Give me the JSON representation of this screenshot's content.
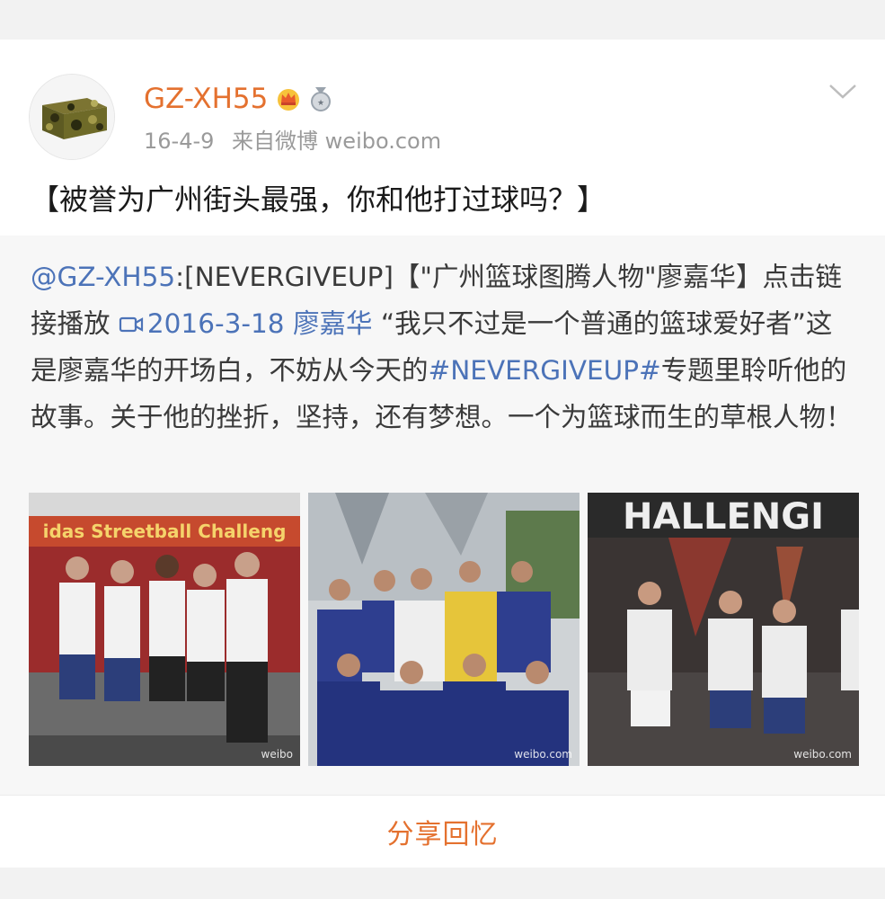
{
  "post": {
    "username": "GZ-XH55",
    "badges": [
      "crown-badge-icon",
      "medal-badge-icon"
    ],
    "timestamp": "16-4-9",
    "source": "来自微博 weibo.com",
    "text": "【被誉为广州街头最强，你和他打过球吗？】"
  },
  "repost": {
    "mention": "@GZ-XH55",
    "segment1": ":[NEVERGIVEUP]【\"广州篮球图腾人物\"廖嘉华】点击链接播放 ",
    "video_link": "2016-3-18 廖嘉华",
    "segment2": " “我只不过是一个普通的篮球爱好者”这是廖嘉华的开场白，不妨从今天的",
    "hashtag": "#NEVERGIVEUP#",
    "segment3": "专题里聆听他的故事。关于他的挫折，坚持，还有梦想。一个为篮球而生的草根人物！",
    "photos": [
      {
        "name": "photo-team-streetball",
        "banner": "idas Streetball Challeng",
        "watermark": "weibo"
      },
      {
        "name": "photo-team-blue",
        "watermark": "weibo.com"
      },
      {
        "name": "photo-challenge-stage",
        "banner": "HALLENGI",
        "watermark": "weibo.com"
      }
    ]
  },
  "actions": {
    "share_label": "分享回忆"
  },
  "colors": {
    "accent": "#e4712f",
    "link": "#4c73b8",
    "text": "#1a1a1a",
    "meta": "#9a9a9a"
  }
}
